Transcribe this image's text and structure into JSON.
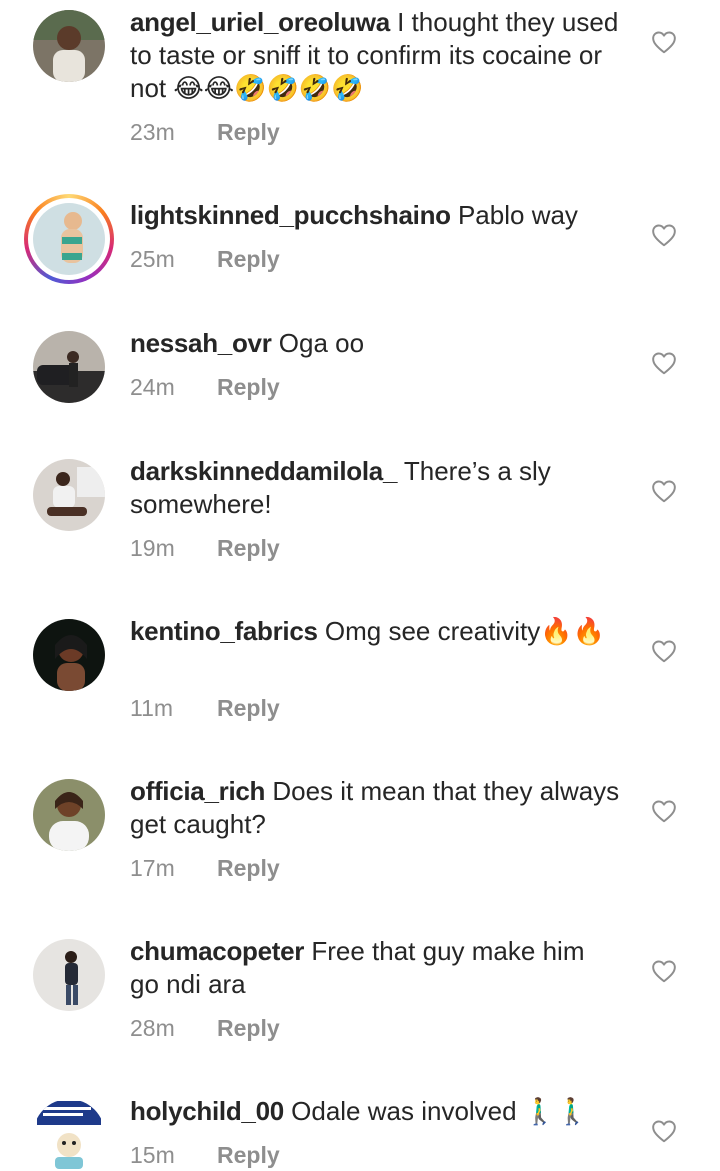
{
  "comments": [
    {
      "username": "angel_uriel_oreoluwa",
      "text": "I thought they used to taste or sniff it to confirm its cocaine or not 😂😂🤣🤣🤣🤣",
      "time": "23m",
      "reply_label": "Reply",
      "avatar_icon": "user-avatar-photo"
    },
    {
      "username": "lightskinned_pucchshaino",
      "text": "Pablo way",
      "time": "25m",
      "reply_label": "Reply",
      "avatar_icon": "user-avatar-photo-story-ring"
    },
    {
      "username": "nessah_ovr",
      "text": "Oga oo",
      "time": "24m",
      "reply_label": "Reply",
      "avatar_icon": "user-avatar-photo"
    },
    {
      "username": "darkskinneddamilola_",
      "text": "There’s a sly somewhere!",
      "time": "19m",
      "reply_label": "Reply",
      "avatar_icon": "user-avatar-photo"
    },
    {
      "username": "kentino_fabrics",
      "text": "Omg see creativity🔥🔥",
      "time": "11m",
      "reply_label": "Reply",
      "avatar_icon": "user-avatar-photo"
    },
    {
      "username": "officia_rich",
      "text": "Does it mean that they always get caught?",
      "time": "17m",
      "reply_label": "Reply",
      "avatar_icon": "user-avatar-photo"
    },
    {
      "username": "chumacopeter",
      "text": "Free that guy make him go ndi ara",
      "time": "28m",
      "reply_label": "Reply",
      "avatar_icon": "user-avatar-photo"
    },
    {
      "username": "holychild_00",
      "text": "Odale was involved 🚶‍♂️🚶‍♂️",
      "time": "15m",
      "reply_label": "Reply",
      "avatar_icon": "user-avatar-photo"
    }
  ],
  "icons": {
    "like": "heart-outline-icon"
  },
  "colors": {
    "text": "#262626",
    "secondary": "#8e8e8e",
    "background": "#ffffff"
  }
}
